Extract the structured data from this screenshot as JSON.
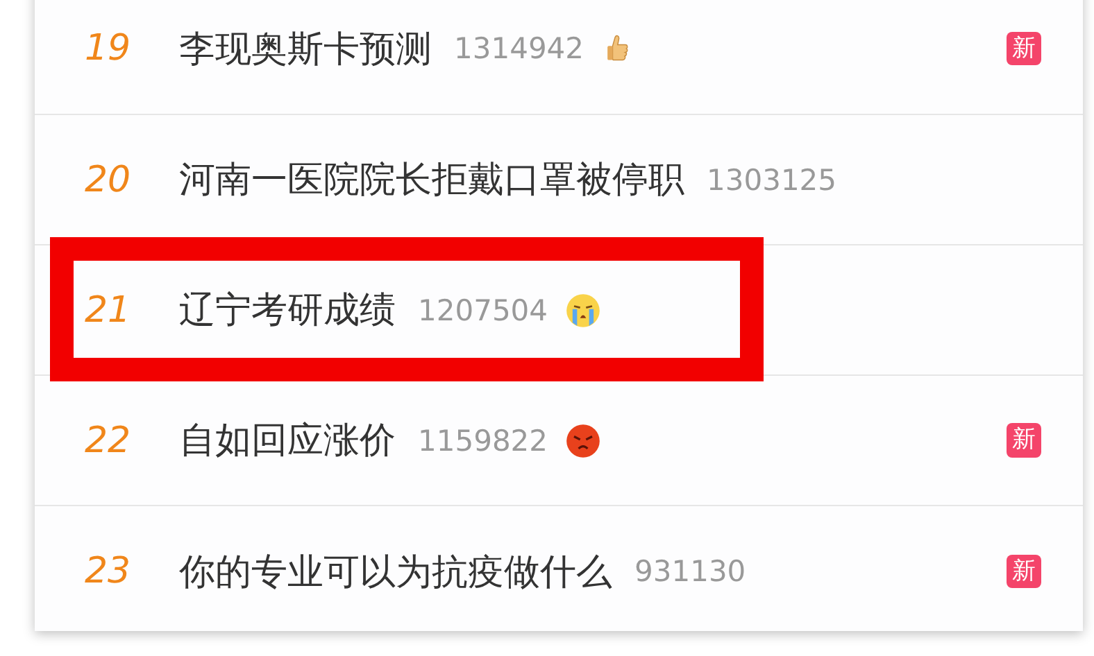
{
  "trending": [
    {
      "rank": "19",
      "title": "李现奥斯卡预测",
      "count": "1314942",
      "kind": "thumbs-up",
      "badge": "新",
      "highlighted": false
    },
    {
      "rank": "20",
      "title": "河南一医院院长拒戴口罩被停职",
      "count": "1303125",
      "highlighted": false
    },
    {
      "rank": "21",
      "title": "辽宁考研成绩",
      "count": "1207504",
      "kind": "crying",
      "highlighted": true
    },
    {
      "rank": "22",
      "title": "自如回应涨价",
      "count": "1159822",
      "kind": "angry",
      "badge": "新",
      "highlighted": false
    },
    {
      "rank": "23",
      "title": "你的专业可以为抗疫做什么",
      "count": "931130",
      "badge": "新",
      "highlighted": false
    }
  ]
}
